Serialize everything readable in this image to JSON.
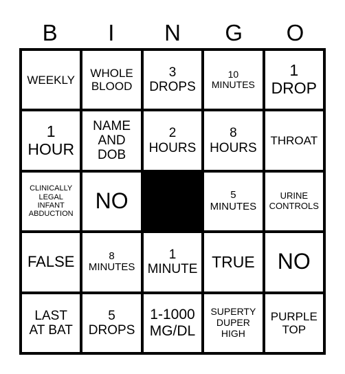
{
  "header": {
    "letters": [
      "B",
      "I",
      "N",
      "G",
      "O"
    ]
  },
  "card": {
    "free_space": {
      "label": "",
      "color": "#000000"
    },
    "rows": [
      [
        "WEEKLY",
        "WHOLE\nBLOOD",
        "3\nDROPS",
        "10\nMINUTES",
        "1\nDROP"
      ],
      [
        "1\nHOUR",
        "NAME\nAND\nDOB",
        "2\nHOURS",
        "8\nHOURS",
        "THROAT"
      ],
      [
        "CLINICALLY\nLEGAL\nINFANT\nABDUCTION",
        "NO",
        "",
        "5\nMINUTES",
        "URINE\nCONTROLS"
      ],
      [
        "FALSE",
        "8\nMINUTES",
        "1\nMINUTE",
        "TRUE",
        "NO"
      ],
      [
        "LAST\nAT BAT",
        "5\nDROPS",
        "1-1000\nMG/DL",
        "SUPERTY\nDUPER\nHIGH",
        "PURPLE\nTOP"
      ]
    ]
  }
}
